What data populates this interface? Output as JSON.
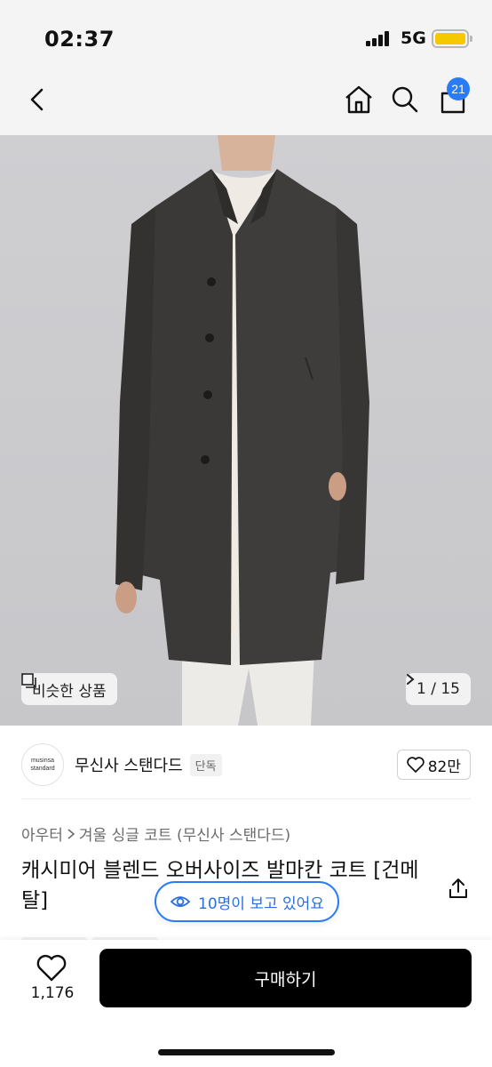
{
  "status_bar": {
    "time": "02:37",
    "network": "5G"
  },
  "nav": {
    "cart_badge": "21"
  },
  "hero": {
    "similar_label": "비슷한 상품",
    "pager_label": "1 / 15",
    "logo_lines": [
      "musinsa",
      "standard"
    ]
  },
  "brand": {
    "name": "무신사 스탠다드",
    "exclusive_tag": "단독",
    "likes": "82만"
  },
  "breadcrumb": {
    "category": "아우터",
    "subcategory": "겨울 싱글 코트 (무신사 스탠다드)"
  },
  "product": {
    "title": "캐시미어 블렌드 오버사이즈 발마칸 코트 [건메탈]",
    "viewers": "10명이 보고 있어요"
  },
  "bottom_bar": {
    "like_count": "1,176",
    "buy_label": "구매하기"
  },
  "colors": {
    "accent": "#2a7bf6",
    "badge": "#2a7bf6",
    "buy_button": "#000000",
    "battery": "#f5c900"
  }
}
